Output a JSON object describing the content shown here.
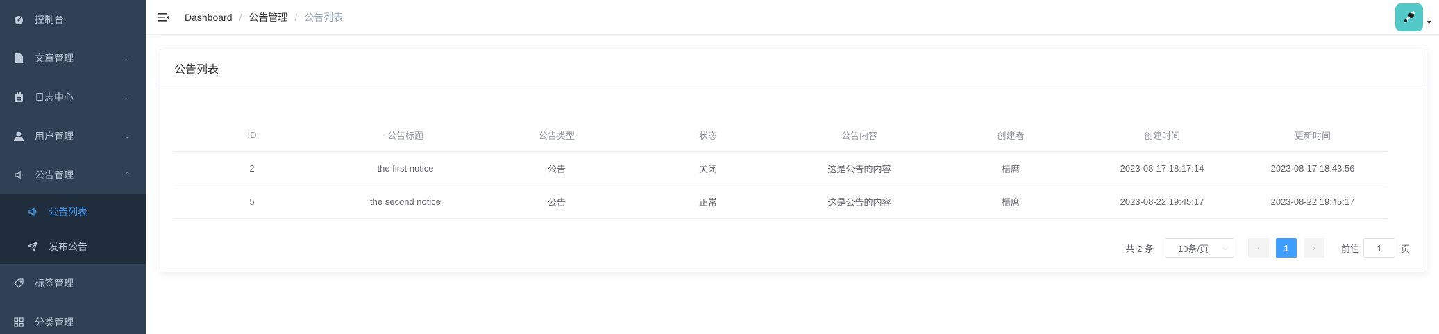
{
  "sidebar": {
    "items": [
      {
        "label": "控制台",
        "icon": "dashboard-icon",
        "arrow": ""
      },
      {
        "label": "文章管理",
        "icon": "document-icon",
        "arrow": "⌄"
      },
      {
        "label": "日志中心",
        "icon": "log-icon",
        "arrow": "⌄"
      },
      {
        "label": "用户管理",
        "icon": "user-icon",
        "arrow": "⌄"
      },
      {
        "label": "公告管理",
        "icon": "speaker-icon",
        "arrow": "⌃"
      },
      {
        "label": "标签管理",
        "icon": "tag-icon",
        "arrow": ""
      },
      {
        "label": "分类管理",
        "icon": "grid-icon",
        "arrow": ""
      }
    ],
    "submenu": [
      {
        "label": "公告列表",
        "icon": "speaker-icon",
        "active": true
      },
      {
        "label": "发布公告",
        "icon": "send-icon",
        "active": false
      }
    ]
  },
  "navbar": {
    "breadcrumb": [
      "Dashboard",
      "公告管理",
      "公告列表"
    ],
    "separator": "/"
  },
  "card": {
    "title": "公告列表"
  },
  "table": {
    "headers": [
      "ID",
      "公告标题",
      "公告类型",
      "状态",
      "公告内容",
      "创建者",
      "创建时间",
      "更新时间"
    ],
    "rows": [
      [
        "2",
        "the first notice",
        "公告",
        "关闭",
        "这是公告的内容",
        "梧席",
        "2023-08-17 18:17:14",
        "2023-08-17 18:43:56"
      ],
      [
        "5",
        "the second notice",
        "公告",
        "正常",
        "这是公告的内容",
        "梧席",
        "2023-08-22 19:45:17",
        "2023-08-22 19:45:17"
      ]
    ]
  },
  "pagination": {
    "total": "共 2 条",
    "page_size": "10条/页",
    "current_page": "1",
    "goto_label": "前往",
    "goto_value": "1",
    "page_suffix": "页"
  },
  "colors": {
    "sidebar_bg": "#304156",
    "submenu_bg": "#1f2d3d",
    "accent": "#409eff",
    "avatar_bg": "#52c8c9"
  }
}
